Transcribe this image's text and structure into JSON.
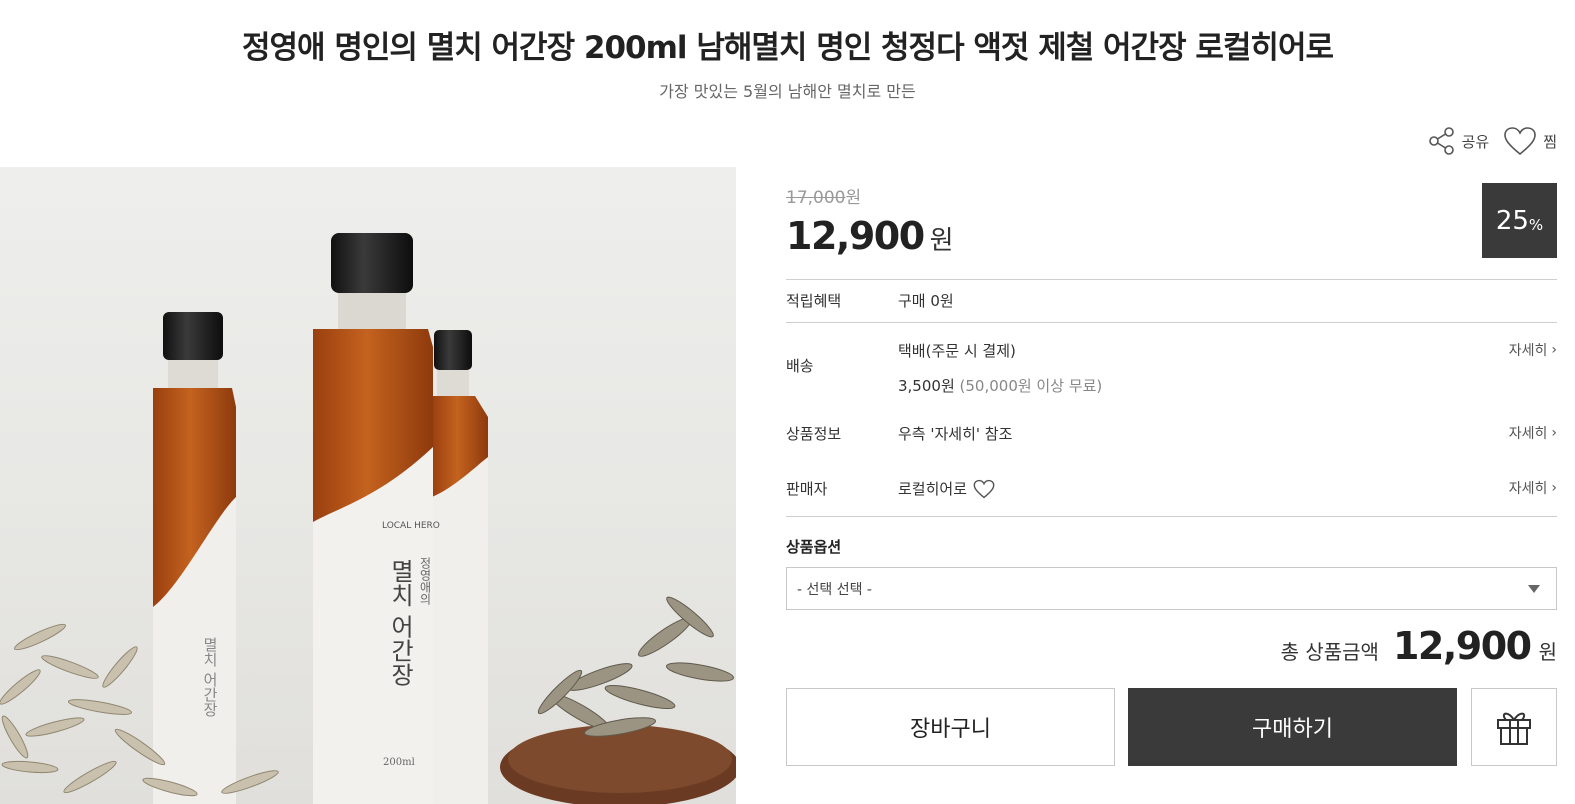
{
  "product": {
    "title": "정영애 명인의 멸치 어간장 200ml 남해멸치 명인 청정다 액젓 제철 어간장 로컬히어로",
    "subtitle": "가장 맛있는 5월의 남해안 멸치로 만든"
  },
  "actions": {
    "share_label": "공유",
    "wish_label": "찜"
  },
  "image": {
    "bottle_label_title": "멸치 어간장",
    "bottle_label_maker": "정영애의",
    "bottle_volume": "200ml",
    "bottle_brand": "LOCAL HERO"
  },
  "price": {
    "original": "17,000",
    "original_unit": "원",
    "sale": "12,900",
    "sale_unit": "원",
    "discount": "25",
    "discount_unit": "%"
  },
  "info": {
    "points_label": "적립혜택",
    "points_value": "구매 0원",
    "shipping_label": "배송",
    "shipping_method": "택배(주문 시 결제)",
    "shipping_fee": "3,500원",
    "shipping_note": "(50,000원 이상 무료)",
    "product_info_label": "상품정보",
    "product_info_value": "우측 '자세히' 참조",
    "seller_label": "판매자",
    "seller_value": "로컬히어로",
    "more_label": "자세히"
  },
  "options": {
    "label": "상품옵션",
    "selected": "- 선택 선택 -"
  },
  "total": {
    "label": "총 상품금액",
    "value": "12,900",
    "unit": "원"
  },
  "buttons": {
    "cart": "장바구니",
    "buy": "구매하기"
  },
  "colors": {
    "dark_button": "#3a3a3a",
    "divider": "#cfcfcf",
    "soy_sauce": "#b8561b"
  }
}
